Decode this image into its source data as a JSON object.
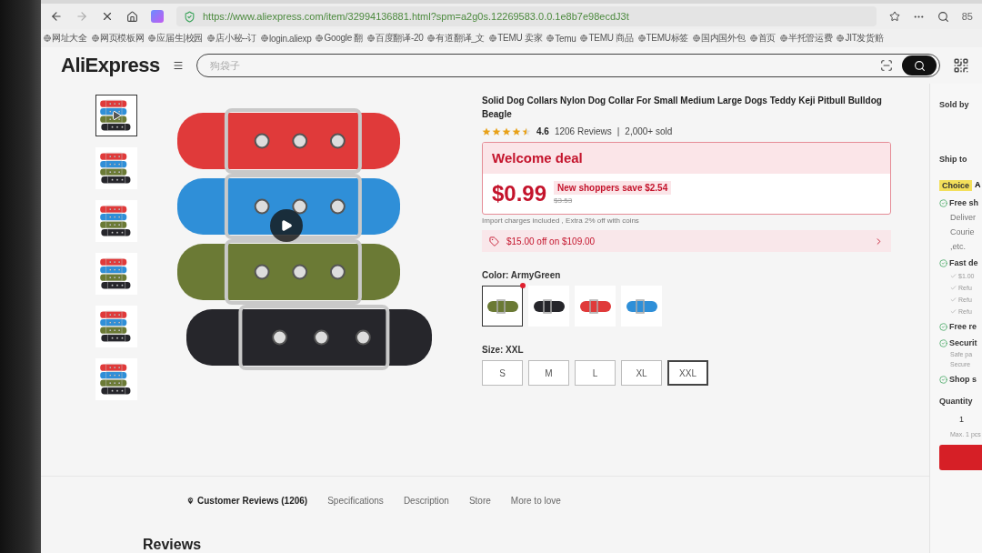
{
  "browser": {
    "url": "https://www.aliexpress.com/item/32994136881.html?spm=a2g0s.12269583.0.0.1e8b7e98ecdJ3t",
    "corner_text": "85"
  },
  "bookmarks": [
    {
      "label": "网址大全"
    },
    {
      "label": "网页模板网"
    },
    {
      "label": "应届生|校园"
    },
    {
      "label": "店小秘--订"
    },
    {
      "label": "login.aliexp"
    },
    {
      "label": "Google 翻"
    },
    {
      "label": "百度翻译-20"
    },
    {
      "label": "有道翻译_文"
    },
    {
      "label": "TEMU 卖家"
    },
    {
      "label": "Temu"
    },
    {
      "label": "TEMU 商品"
    },
    {
      "label": "TEMU标签"
    },
    {
      "label": "国内国外包"
    },
    {
      "label": "首页"
    },
    {
      "label": "半托管运费"
    },
    {
      "label": "JIT发货赔"
    }
  ],
  "header": {
    "logo": "AliExpress",
    "search": {
      "placeholder": "狗袋子"
    }
  },
  "gallery": {
    "thumbnails": [
      {
        "kind": "video",
        "selected": true
      },
      {
        "kind": "image",
        "selected": false
      },
      {
        "kind": "image",
        "selected": false
      },
      {
        "kind": "image",
        "selected": false
      },
      {
        "kind": "image",
        "selected": false
      },
      {
        "kind": "image",
        "selected": false
      }
    ]
  },
  "product": {
    "title": "Solid Dog Collars Nylon Dog Collar For Small Medium Large Dogs Teddy Keji Pitbull Bulldog Beagle",
    "stars": 4.5,
    "rating": "4.6",
    "reviews": "1206 Reviews",
    "separator": "|",
    "sold": "2,000+ sold"
  },
  "deal": {
    "title": "Welcome deal",
    "price": "$0.99",
    "save": "New shoppers save $2.54",
    "original": "$3.53"
  },
  "note": "Import charges included , Extra 2% off with coins",
  "coupon": {
    "text": "$15.00 off on $109.00"
  },
  "color": {
    "label": "Color: ArmyGreen",
    "swatches": [
      {
        "color": "#6b7a35",
        "selected": true
      },
      {
        "color": "#26262b",
        "selected": false
      },
      {
        "color": "#e03a3a",
        "selected": false
      },
      {
        "color": "#2f8fd8",
        "selected": false
      }
    ]
  },
  "size": {
    "label": "Size: XXL",
    "options": [
      {
        "label": "S",
        "selected": false
      },
      {
        "label": "M",
        "selected": false
      },
      {
        "label": "L",
        "selected": false
      },
      {
        "label": "XL",
        "selected": false
      },
      {
        "label": "XXL",
        "selected": true
      }
    ]
  },
  "tabs": [
    {
      "label": "Customer Reviews (1206)",
      "selected": true
    },
    {
      "label": "Specifications",
      "selected": false
    },
    {
      "label": "Description",
      "selected": false
    },
    {
      "label": "Store",
      "selected": false
    },
    {
      "label": "More to love",
      "selected": false
    }
  ],
  "reviews_heading": "Reviews",
  "side_panel": [
    {
      "kind": "heading",
      "text": "Sold by"
    },
    {
      "kind": "spacer"
    },
    {
      "kind": "heading",
      "text": "Ship to"
    },
    {
      "kind": "badge",
      "text": "Choice",
      "extra": "A"
    },
    {
      "kind": "feature",
      "text": "Free sh"
    },
    {
      "kind": "sub",
      "text": "Deliver"
    },
    {
      "kind": "sub",
      "text": "Courie"
    },
    {
      "kind": "sub",
      "text": ",etc."
    },
    {
      "kind": "feature",
      "text": "Fast de"
    },
    {
      "kind": "check",
      "text": "$1.00"
    },
    {
      "kind": "check",
      "text": "Refu"
    },
    {
      "kind": "check",
      "text": "Refu"
    },
    {
      "kind": "check",
      "text": "Refu"
    },
    {
      "kind": "feature",
      "text": "Free re"
    },
    {
      "kind": "feature",
      "text": "Securit"
    },
    {
      "kind": "small",
      "text": "Safe pa"
    },
    {
      "kind": "small",
      "text": "Secure"
    },
    {
      "kind": "feature",
      "text": "Shop s"
    },
    {
      "kind": "heading",
      "text": "Quantity"
    },
    {
      "kind": "qty",
      "text": "1"
    },
    {
      "kind": "small",
      "text": "Max. 1 pcs"
    },
    {
      "kind": "buy"
    }
  ]
}
